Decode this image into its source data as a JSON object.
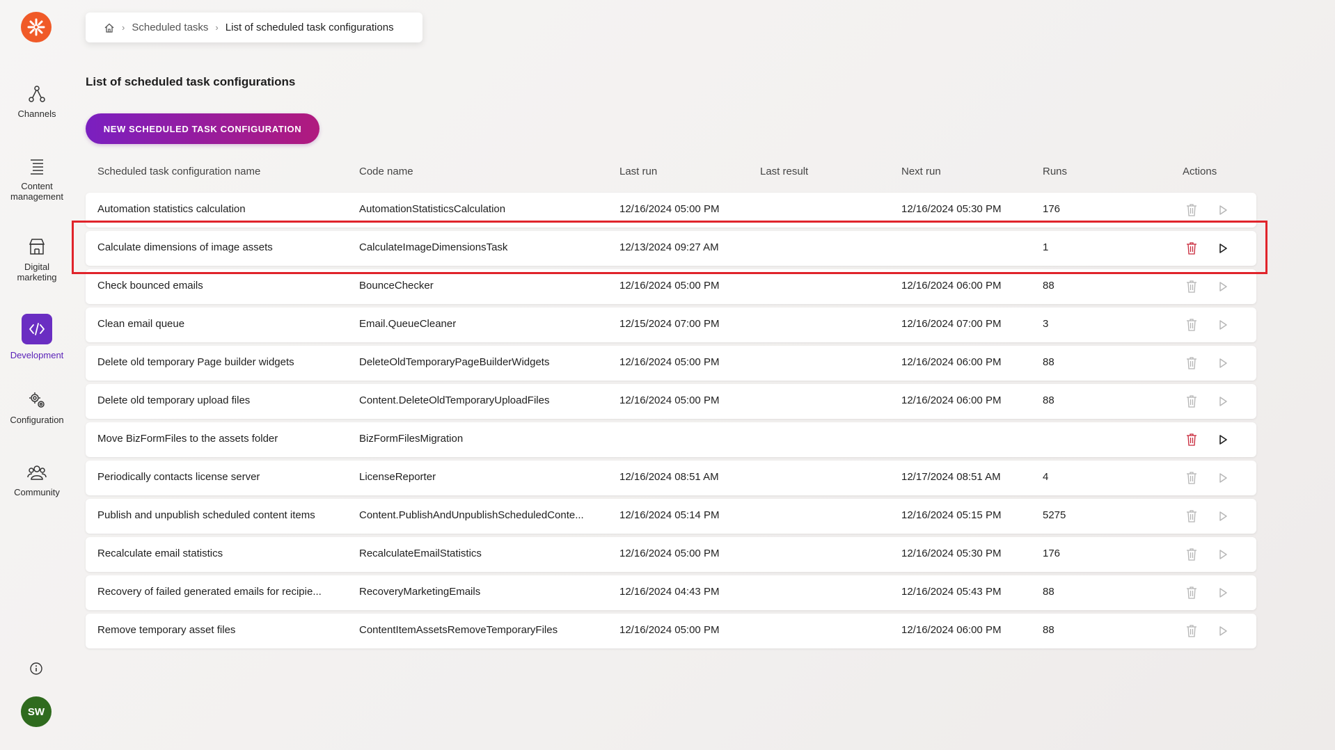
{
  "breadcrumb": {
    "items": [
      "Scheduled tasks",
      "List of scheduled task configurations"
    ]
  },
  "page": {
    "title": "List of scheduled task configurations",
    "new_button_label": "NEW SCHEDULED TASK CONFIGURATION"
  },
  "sidebar": {
    "items": [
      {
        "label": "Channels",
        "icon": "channels-icon"
      },
      {
        "label": "Content management",
        "icon": "content-management-icon"
      },
      {
        "label": "Digital marketing",
        "icon": "digital-marketing-icon"
      },
      {
        "label": "Development",
        "icon": "development-icon",
        "active": true
      },
      {
        "label": "Configuration",
        "icon": "configuration-icon"
      },
      {
        "label": "Community",
        "icon": "community-icon"
      }
    ],
    "avatar_initials": "SW"
  },
  "table": {
    "columns": [
      "Scheduled task configuration name",
      "Code name",
      "Last run",
      "Last result",
      "Next run",
      "Runs",
      "Actions"
    ],
    "rows": [
      {
        "name": "Automation statistics calculation",
        "code": "AutomationStatisticsCalculation",
        "last_run": "12/16/2024 05:00 PM",
        "last_result": "",
        "next_run": "12/16/2024 05:30 PM",
        "runs": "176",
        "enabled": false
      },
      {
        "name": "Calculate dimensions of image assets",
        "code": "CalculateImageDimensionsTask",
        "last_run": "12/13/2024 09:27 AM",
        "last_result": "",
        "next_run": "",
        "runs": "1",
        "enabled": true
      },
      {
        "name": "Check bounced emails",
        "code": "BounceChecker",
        "last_run": "12/16/2024 05:00 PM",
        "last_result": "",
        "next_run": "12/16/2024 06:00 PM",
        "runs": "88",
        "enabled": false
      },
      {
        "name": "Clean email queue",
        "code": "Email.QueueCleaner",
        "last_run": "12/15/2024 07:00 PM",
        "last_result": "",
        "next_run": "12/16/2024 07:00 PM",
        "runs": "3",
        "enabled": false
      },
      {
        "name": "Delete old temporary Page builder widgets",
        "code": "DeleteOldTemporaryPageBuilderWidgets",
        "last_run": "12/16/2024 05:00 PM",
        "last_result": "",
        "next_run": "12/16/2024 06:00 PM",
        "runs": "88",
        "enabled": false
      },
      {
        "name": "Delete old temporary upload files",
        "code": "Content.DeleteOldTemporaryUploadFiles",
        "last_run": "12/16/2024 05:00 PM",
        "last_result": "",
        "next_run": "12/16/2024 06:00 PM",
        "runs": "88",
        "enabled": false
      },
      {
        "name": "Move BizFormFiles to the assets folder",
        "code": "BizFormFilesMigration",
        "last_run": "",
        "last_result": "",
        "next_run": "",
        "runs": "",
        "enabled": true
      },
      {
        "name": "Periodically contacts license server",
        "code": "LicenseReporter",
        "last_run": "12/16/2024 08:51 AM",
        "last_result": "",
        "next_run": "12/17/2024 08:51 AM",
        "runs": "4",
        "enabled": false
      },
      {
        "name": "Publish and unpublish scheduled content items",
        "code": "Content.PublishAndUnpublishScheduledConte...",
        "last_run": "12/16/2024 05:14 PM",
        "last_result": "",
        "next_run": "12/16/2024 05:15 PM",
        "runs": "5275",
        "enabled": false
      },
      {
        "name": "Recalculate email statistics",
        "code": "RecalculateEmailStatistics",
        "last_run": "12/16/2024 05:00 PM",
        "last_result": "",
        "next_run": "12/16/2024 05:30 PM",
        "runs": "176",
        "enabled": false
      },
      {
        "name": "Recovery of failed generated emails for recipie...",
        "code": "RecoveryMarketingEmails",
        "last_run": "12/16/2024 04:43 PM",
        "last_result": "",
        "next_run": "12/16/2024 05:43 PM",
        "runs": "88",
        "enabled": false
      },
      {
        "name": "Remove temporary asset files",
        "code": "ContentItemAssetsRemoveTemporaryFiles",
        "last_run": "12/16/2024 05:00 PM",
        "last_result": "",
        "next_run": "12/16/2024 06:00 PM",
        "runs": "88",
        "enabled": false
      }
    ]
  },
  "colors": {
    "brand_orange": "#f05a28",
    "accent_purple": "#6a2ec2",
    "delete_active": "#c8283a",
    "highlight_red": "#e0242b"
  }
}
